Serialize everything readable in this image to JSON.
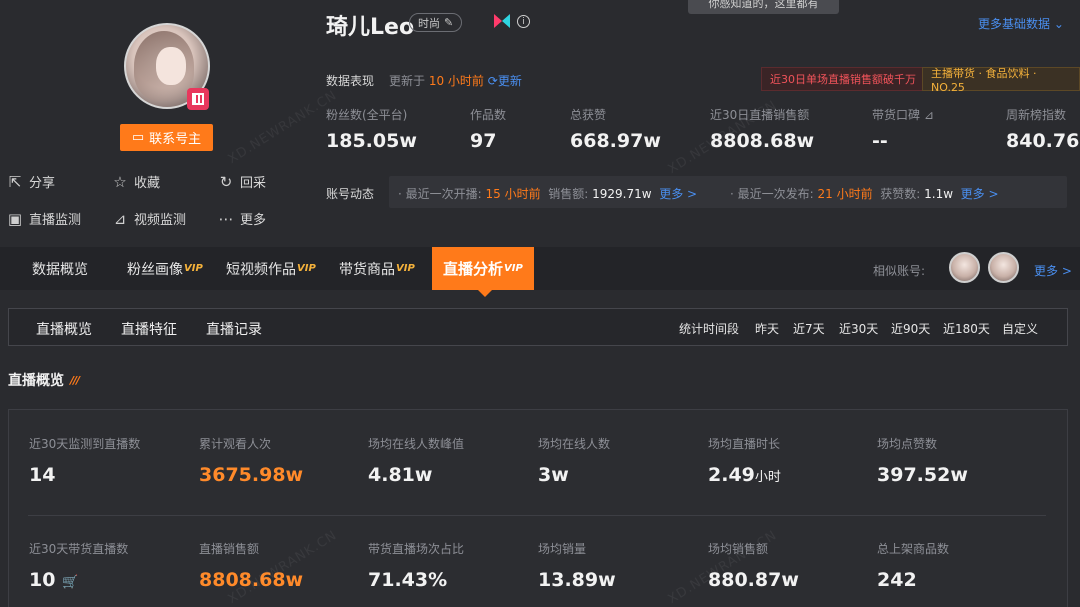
{
  "profile": {
    "name": "琦儿Leo",
    "category_tag": "时尚",
    "contact_button": "联系号主",
    "actions": [
      {
        "label": "分享",
        "icon": "share-icon"
      },
      {
        "label": "收藏",
        "icon": "star-icon"
      },
      {
        "label": "回采",
        "icon": "refresh-icon"
      },
      {
        "label": "直播监测",
        "icon": "live-icon"
      },
      {
        "label": "视频监测",
        "icon": "chart-icon"
      },
      {
        "label": "更多",
        "icon": "more-icon"
      }
    ]
  },
  "tooltip": "你感知道的，这里都有",
  "more_basic": "更多基础数据",
  "performance": {
    "label": "数据表现",
    "updated_prefix": "更新于",
    "updated_time": "10 小时前",
    "update_link": "更新",
    "badge_red": "近30日单场直播销售额破千万",
    "badge_gold": "主播带货 · 食品饮料 · NO.25"
  },
  "stats": [
    {
      "label": "粉丝数(全平台)",
      "value": "185.05w"
    },
    {
      "label": "作品数",
      "value": "97"
    },
    {
      "label": "总获赞",
      "value": "668.97w"
    },
    {
      "label": "近30日直播销售额",
      "value": "8808.68w"
    },
    {
      "label": "带货口碑",
      "value": "--"
    },
    {
      "label": "周新榜指数",
      "value": "840.76"
    }
  ],
  "dynamics": {
    "label": "账号动态",
    "live_prefix": "· 最近一次开播:",
    "live_time": "15 小时前",
    "sales_label": "销售额:",
    "sales_value": "1929.71w",
    "more1": "更多 >",
    "post_prefix": "· 最近一次发布:",
    "post_time": "21 小时前",
    "likes_label": "获赞数:",
    "likes_value": "1.1w",
    "more2": "更多 >"
  },
  "tabs": [
    {
      "label": "数据概览",
      "vip": ""
    },
    {
      "label": "粉丝画像",
      "vip": "VIP"
    },
    {
      "label": "短视频作品",
      "vip": "VIP"
    },
    {
      "label": "带货商品",
      "vip": "VIP"
    },
    {
      "label": "直播分析",
      "vip": "VIP"
    }
  ],
  "similar": {
    "label": "相似账号:",
    "more": "更多 >"
  },
  "subtabs": [
    "直播概览",
    "直播特征",
    "直播记录"
  ],
  "range": {
    "label": "统计时间段",
    "options": [
      "昨天",
      "近7天",
      "近30天",
      "近90天",
      "近180天",
      "自定义"
    ],
    "selected": "近30天"
  },
  "section_title": "直播概览",
  "metrics_row1": [
    {
      "label": "近30天监测到直播数",
      "value": "14",
      "unit": ""
    },
    {
      "label": "累计观看人次",
      "value": "3675.98w",
      "unit": ""
    },
    {
      "label": "场均在线人数峰值",
      "value": "4.81w",
      "unit": ""
    },
    {
      "label": "场均在线人数",
      "value": "3w",
      "unit": ""
    },
    {
      "label": "场均直播时长",
      "value": "2.49",
      "unit": "小时"
    },
    {
      "label": "场均点赞数",
      "value": "397.52w",
      "unit": ""
    }
  ],
  "metrics_row2": [
    {
      "label": "近30天带货直播数",
      "value": "10",
      "unit": ""
    },
    {
      "label": "直播销售额",
      "value": "8808.68w",
      "unit": ""
    },
    {
      "label": "带货直播场次占比",
      "value": "71.43%",
      "unit": ""
    },
    {
      "label": "场均销量",
      "value": "13.89w",
      "unit": ""
    },
    {
      "label": "场均销售额",
      "value": "880.87w",
      "unit": ""
    },
    {
      "label": "总上架商品数",
      "value": "242",
      "unit": ""
    }
  ],
  "watermark": "XD.NEWRANK.CN",
  "colors": {
    "accent": "#ff7a1a",
    "link": "#4a8ff0",
    "gold": "#f5b23b",
    "red": "#f0535a"
  }
}
